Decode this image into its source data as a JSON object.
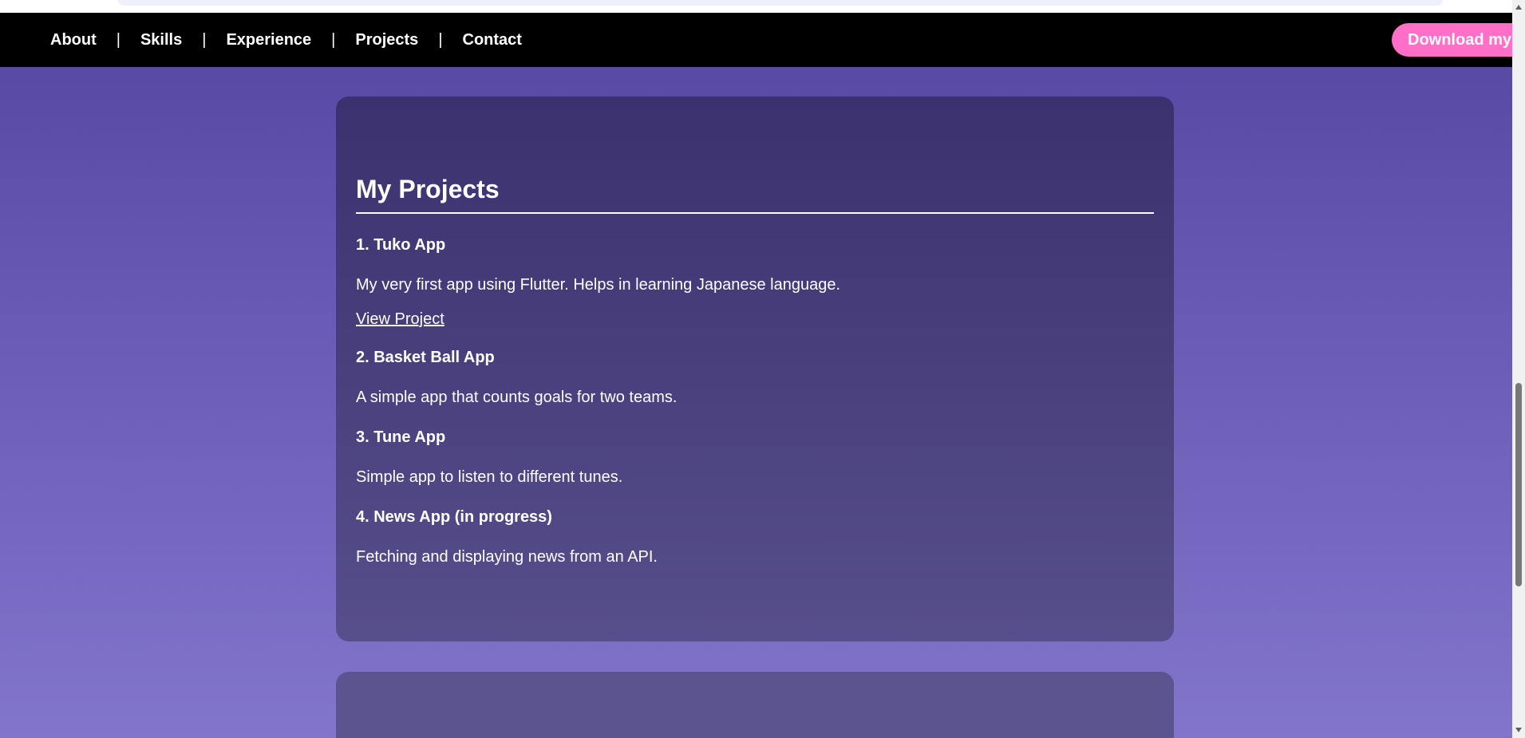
{
  "nav": {
    "links": [
      "About",
      "Skills",
      "Experience",
      "Projects",
      "Contact"
    ],
    "separator": "|",
    "download_label": "Download my"
  },
  "projects": {
    "title": "My Projects",
    "items": [
      {
        "name": "1. Tuko App",
        "description": "My very first app using Flutter. Helps in learning Japanese language.",
        "link": "View Project"
      },
      {
        "name": "2. Basket Ball App",
        "description": "A simple app that counts goals for two teams."
      },
      {
        "name": "3. Tune App",
        "description": "Simple app to listen to different tunes."
      },
      {
        "name": "4. News App (in progress)",
        "description": "Fetching and displaying news from an API."
      }
    ]
  },
  "colors": {
    "navbar_bg": "#000000",
    "accent_pink": "#ff6ec7",
    "page_gradient_top": "#5345a0",
    "page_gradient_bottom": "#8275cb",
    "card_bg": "#3b316e"
  }
}
